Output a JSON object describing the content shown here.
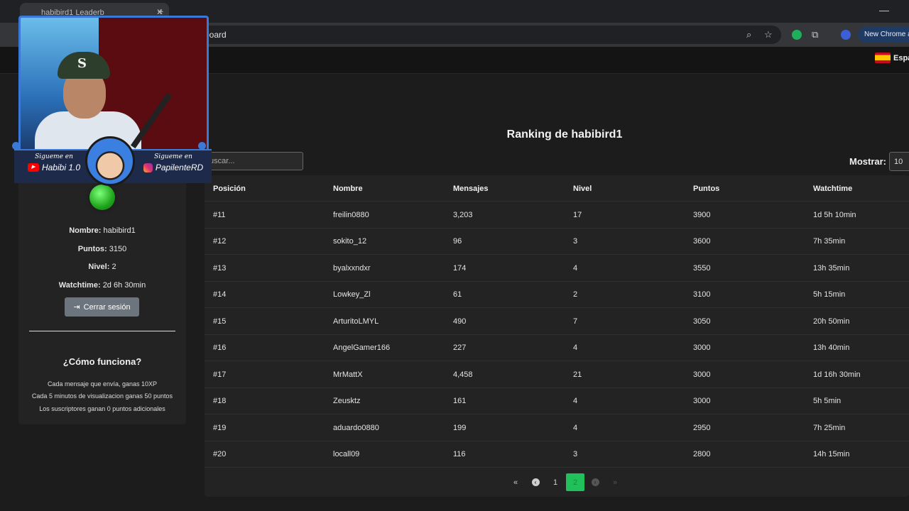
{
  "browser": {
    "tab_title": "habibird1 Leaderb",
    "address_tail": "board",
    "new_chrome": "New Chrome av"
  },
  "site": {
    "language": "Espa"
  },
  "user": {
    "name_label": "Nombre:",
    "name": "habibird1",
    "points_label": "Puntos:",
    "points": "3150",
    "level_label": "Nivel:",
    "level": "2",
    "watch_label": "Watchtime:",
    "watch": "2d 6h 30min",
    "logout": "Cerrar sesión"
  },
  "how": {
    "title": "¿Cómo funciona?",
    "lines": [
      "Cada mensaje que envía, ganas 10XP",
      "Cada 5 minutos de visualizacion ganas 50 puntos",
      "Los suscriptores ganan 0 puntos adicionales"
    ]
  },
  "ranking": {
    "title": "Ranking de habibird1",
    "search_placeholder": "uscar...",
    "show_label": "Mostrar:",
    "show_value": "10",
    "columns": [
      "Posición",
      "Nombre",
      "Mensajes",
      "Nivel",
      "Puntos",
      "Watchtime"
    ],
    "rows": [
      [
        "#11",
        "freilin0880",
        "3,203",
        "17",
        "3900",
        "1d 5h 10min"
      ],
      [
        "#12",
        "sokito_12",
        "96",
        "3",
        "3600",
        "7h 35min"
      ],
      [
        "#13",
        "byalxxndxr",
        "174",
        "4",
        "3550",
        "13h 35min"
      ],
      [
        "#14",
        "Lowkey_Zl",
        "61",
        "2",
        "3100",
        "5h 15min"
      ],
      [
        "#15",
        "ArturitoLMYL",
        "490",
        "7",
        "3050",
        "20h 50min"
      ],
      [
        "#16",
        "AngelGamer166",
        "227",
        "4",
        "3000",
        "13h 40min"
      ],
      [
        "#17",
        "MrMattX",
        "4,458",
        "21",
        "3000",
        "1d 16h 30min"
      ],
      [
        "#18",
        "Zeusktz",
        "161",
        "4",
        "3000",
        "5h 5min"
      ],
      [
        "#19",
        "aduardo0880",
        "199",
        "4",
        "2950",
        "7h 25min"
      ],
      [
        "#20",
        "locall09",
        "116",
        "3",
        "2800",
        "14h 15min"
      ]
    ],
    "pagination": {
      "first": "«",
      "prev": "‹",
      "pages": [
        "1",
        "2"
      ],
      "active": "2",
      "next": "›",
      "last": "»"
    }
  },
  "overlay": {
    "follow_label": "Sigueme en",
    "youtube": "Habibi 1.0",
    "instagram": "PapilenteRD",
    "cap_logo": "S"
  }
}
